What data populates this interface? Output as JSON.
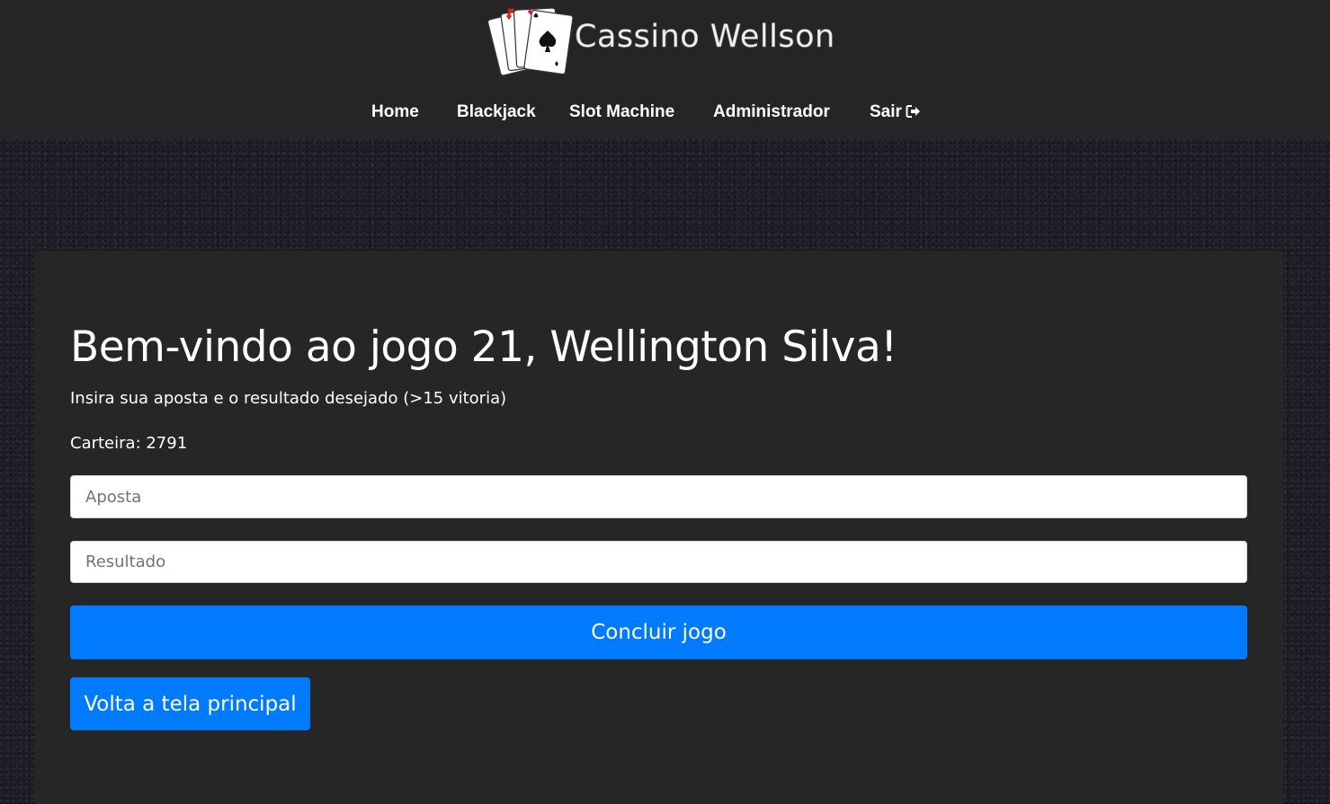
{
  "brand": {
    "name": "Cassino Wellson",
    "logo_icon": "playing-cards-icon"
  },
  "nav": {
    "items": [
      {
        "label": "Home"
      },
      {
        "label": "Blackjack"
      },
      {
        "label": "Slot Machine"
      },
      {
        "label": "Administrador"
      },
      {
        "label": "Sair",
        "icon": "sign-out-icon"
      }
    ]
  },
  "game": {
    "title": "Bem-vindo ao jogo 21, Wellington Silva!",
    "instructions": "Insira sua aposta e o resultado desejado (>15 vitoria)",
    "wallet_text": "Carteira: 2791",
    "bet_placeholder": "Aposta",
    "result_placeholder": "Resultado",
    "submit_label": "Concluir jogo",
    "back_label": "Volta a tela principal"
  },
  "colors": {
    "header_bg": "#252525",
    "card_bg": "#262626",
    "primary_button": "#007bff",
    "page_bg": "#1e1f27"
  }
}
